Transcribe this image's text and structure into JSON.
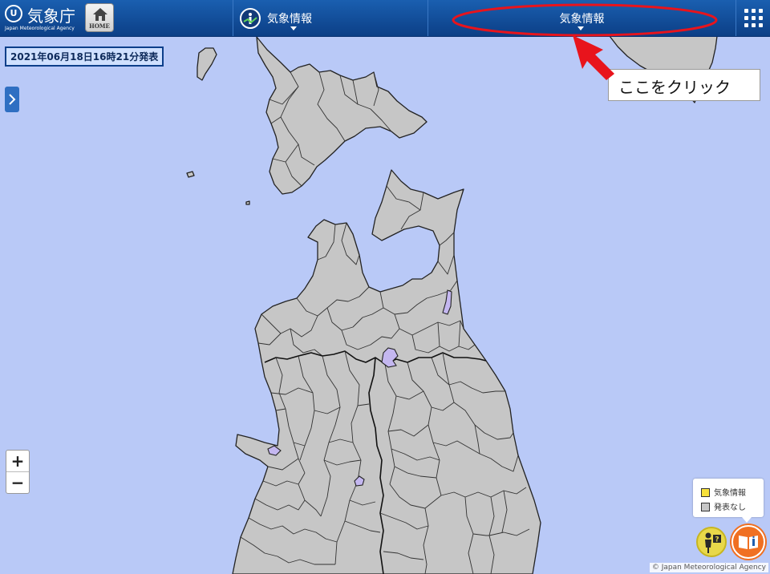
{
  "header": {
    "agency_name": "気象庁",
    "agency_name_en": "Japan Meteorological Agency",
    "home_label": "HOME",
    "menu_primary_label": "気象情報",
    "menu_secondary_label": "気象情報"
  },
  "map": {
    "issued_at": "2021年06月18日16時21分発表"
  },
  "zoom": {
    "in_label": "+",
    "out_label": "−"
  },
  "legend": {
    "items": [
      {
        "label": "気象情報",
        "color": "#f7e13b"
      },
      {
        "label": "発表なし",
        "color": "#c6c6c6"
      }
    ]
  },
  "annotation": {
    "callout_text": "ここをクリック",
    "color": "#e8141c"
  },
  "copyright": "© Japan Meteorological Agency",
  "colors": {
    "sea": "#b9c9f7",
    "land": "#c6c6c6",
    "header": "#0c3f86",
    "highlight_area": "#c4b7f0"
  }
}
